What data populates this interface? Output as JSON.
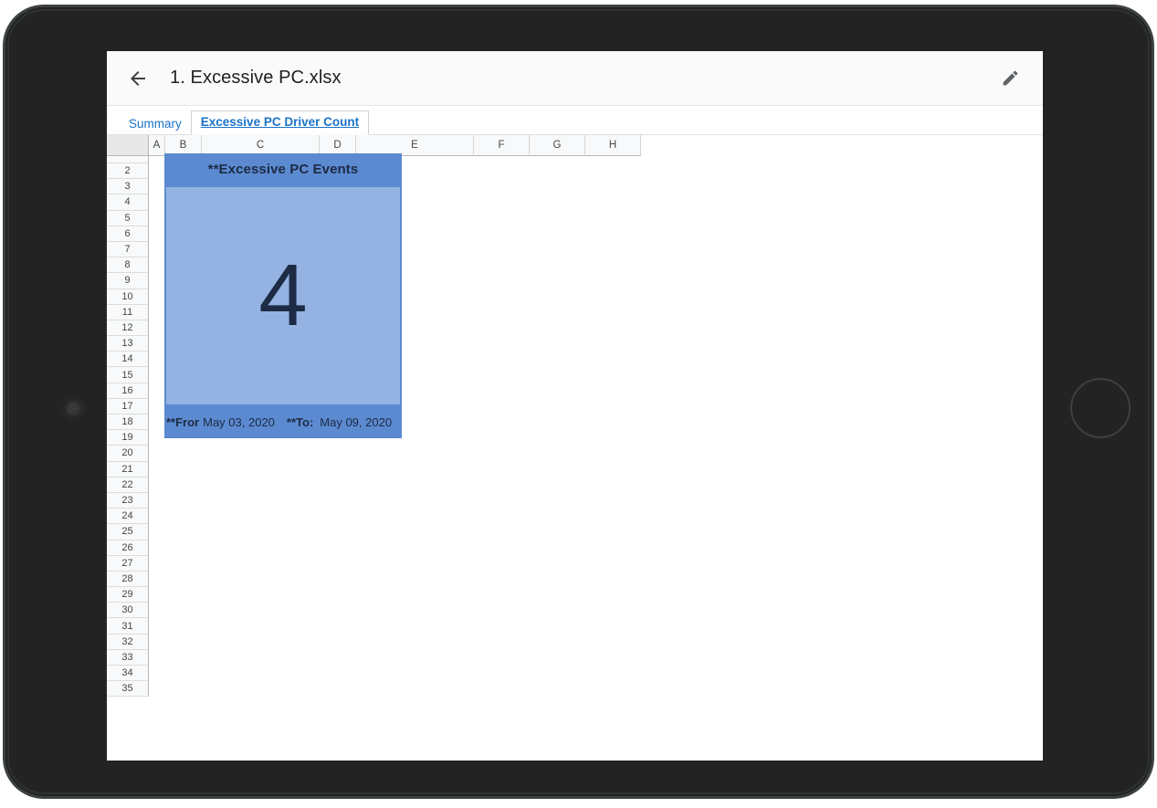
{
  "device": {
    "camera_icon": "camera-lens-icon",
    "home_button_icon": "home-button-icon"
  },
  "app_bar": {
    "back_icon": "arrow-left-icon",
    "title": "1. Excessive PC.xlsx",
    "edit_icon": "pencil-icon"
  },
  "tabs": [
    {
      "label": "Summary",
      "active": false
    },
    {
      "label": "Excessive PC Driver Count",
      "active": true
    }
  ],
  "spreadsheet": {
    "columns": [
      {
        "label": "A",
        "width": 18
      },
      {
        "label": "B",
        "width": 40
      },
      {
        "label": "C",
        "width": 129
      },
      {
        "label": "D",
        "width": 40
      },
      {
        "label": "E",
        "width": 129
      },
      {
        "label": "F",
        "width": 61
      },
      {
        "label": "G",
        "width": 61
      },
      {
        "label": "H",
        "width": 61
      }
    ],
    "rows": [
      "2",
      "3",
      "4",
      "5",
      "6",
      "7",
      "8",
      "9",
      "10",
      "11",
      "12",
      "13",
      "14",
      "15",
      "16",
      "17",
      "18",
      "19",
      "20",
      "21",
      "22",
      "23",
      "24",
      "25",
      "26",
      "27",
      "28",
      "29",
      "30",
      "31",
      "32",
      "33",
      "34",
      "35"
    ]
  },
  "kpi_card": {
    "title": "**Excessive PC Events",
    "value": "4",
    "from_label": "**Fror",
    "from_date": "May 03, 2020",
    "to_label": "**To:",
    "to_date": "May 09, 2020",
    "header_color": "#5b8ad1",
    "body_color": "#94b3e3",
    "text_color": "#1d2b45"
  }
}
